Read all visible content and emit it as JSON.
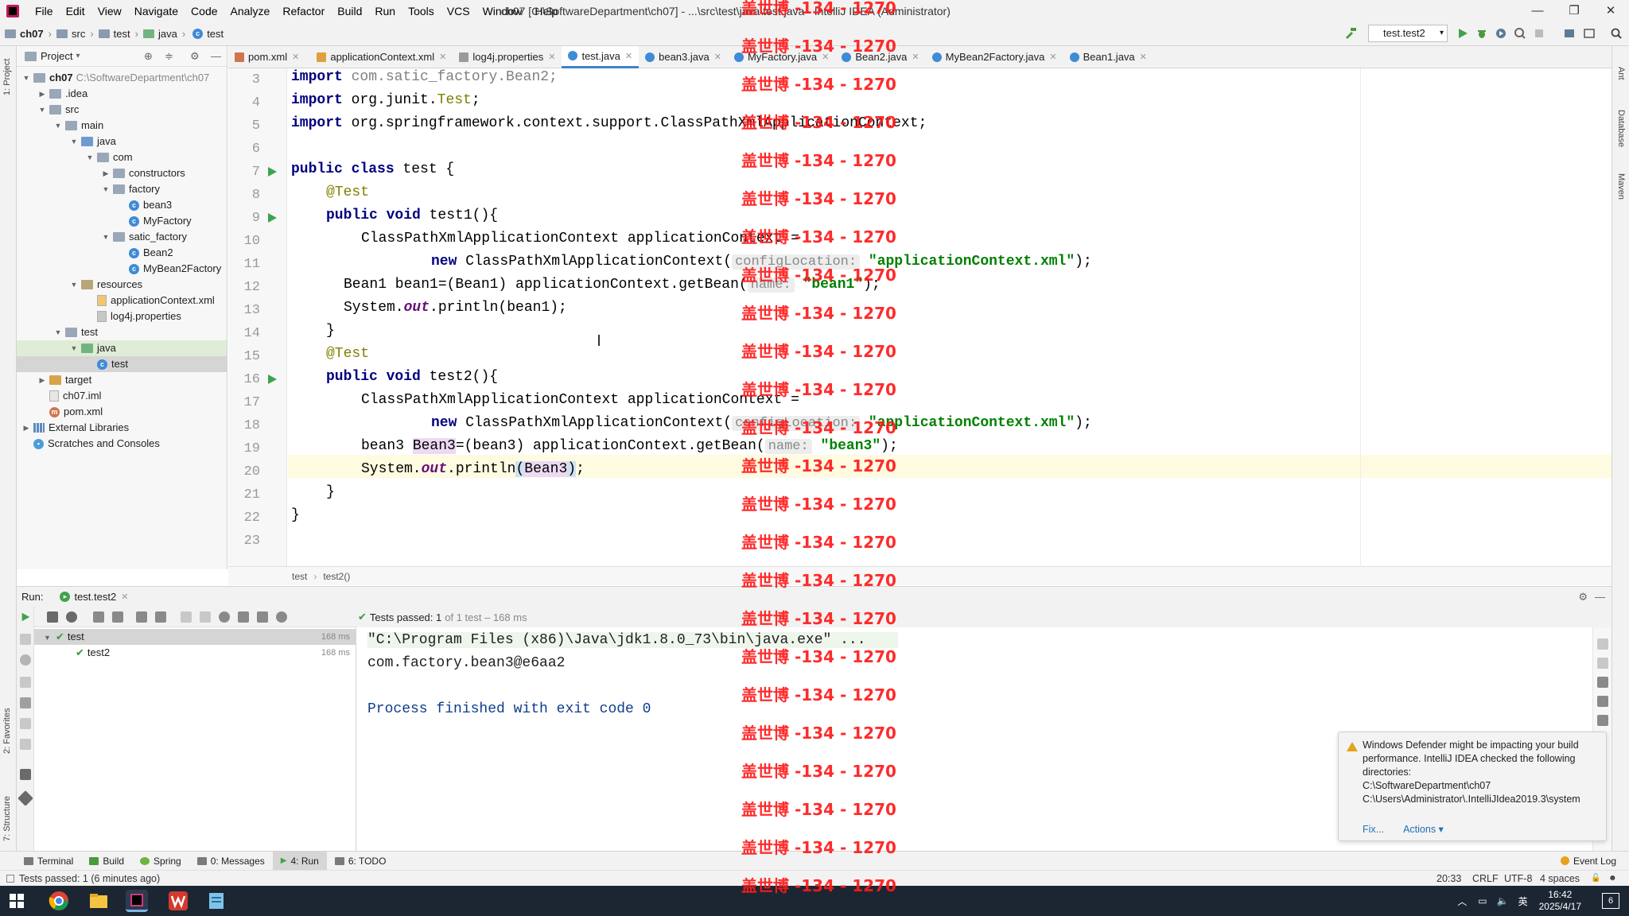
{
  "window": {
    "title": "ch07 [C:\\SoftwareDepartment\\ch07] - ...\\src\\test\\java\\test.java - IntelliJ IDEA (Administrator)",
    "menu": [
      "File",
      "Edit",
      "View",
      "Navigate",
      "Code",
      "Analyze",
      "Refactor",
      "Build",
      "Run",
      "Tools",
      "VCS",
      "Window",
      "Help"
    ],
    "controls": [
      "—",
      "❐",
      "✕"
    ]
  },
  "navbar": {
    "crumbs": [
      "ch07",
      "src",
      "test",
      "java",
      "test"
    ],
    "run_config": "test.test2"
  },
  "left_strip": {
    "project": "1: Project",
    "favorites": "2: Favorites",
    "structure": "7: Structure"
  },
  "right_strip": {
    "ant": "Ant",
    "database": "Database",
    "maven": "Maven"
  },
  "project_panel": {
    "title": "Project",
    "tree": [
      {
        "label": "ch07",
        "extra": "C:\\SoftwareDepartment\\ch07",
        "kind": "folder",
        "depth": 0,
        "expanded": true,
        "bold": true
      },
      {
        "label": ".idea",
        "kind": "folder",
        "depth": 1,
        "expanded": false
      },
      {
        "label": "src",
        "kind": "folder",
        "depth": 1,
        "expanded": true
      },
      {
        "label": "main",
        "kind": "folder",
        "depth": 2,
        "expanded": true
      },
      {
        "label": "java",
        "kind": "src",
        "depth": 3,
        "expanded": true
      },
      {
        "label": "com",
        "kind": "folder",
        "depth": 4,
        "expanded": true
      },
      {
        "label": "constructors",
        "kind": "folder",
        "depth": 5,
        "expanded": false
      },
      {
        "label": "factory",
        "kind": "folder",
        "depth": 5,
        "expanded": true
      },
      {
        "label": "bean3",
        "kind": "class",
        "depth": 6
      },
      {
        "label": "MyFactory",
        "kind": "class",
        "depth": 6
      },
      {
        "label": "satic_factory",
        "kind": "folder",
        "depth": 5,
        "expanded": true
      },
      {
        "label": "Bean2",
        "kind": "class",
        "depth": 6
      },
      {
        "label": "MyBean2Factory",
        "kind": "class",
        "depth": 6
      },
      {
        "label": "resources",
        "kind": "res",
        "depth": 3,
        "expanded": true
      },
      {
        "label": "applicationContext.xml",
        "kind": "xml",
        "depth": 4
      },
      {
        "label": "log4j.properties",
        "kind": "prop",
        "depth": 4
      },
      {
        "label": "test",
        "kind": "folder",
        "depth": 2,
        "expanded": true
      },
      {
        "label": "java",
        "kind": "tst",
        "depth": 3,
        "expanded": true,
        "highlight": true
      },
      {
        "label": "test",
        "kind": "class",
        "depth": 4,
        "selected": true
      },
      {
        "label": "target",
        "kind": "tgt",
        "depth": 1,
        "expanded": false
      },
      {
        "label": "ch07.iml",
        "kind": "file",
        "depth": 1
      },
      {
        "label": "pom.xml",
        "kind": "pom",
        "depth": 1
      },
      {
        "label": "External Libraries",
        "kind": "lib",
        "depth": 0,
        "expanded": false
      },
      {
        "label": "Scratches and Consoles",
        "kind": "scratch",
        "depth": 0
      }
    ]
  },
  "editor_tabs": [
    {
      "label": "pom.xml",
      "icon": "m"
    },
    {
      "label": "applicationContext.xml",
      "icon": "x"
    },
    {
      "label": "log4j.properties",
      "icon": "p"
    },
    {
      "label": "test.java",
      "icon": "c",
      "active": true
    },
    {
      "label": "bean3.java",
      "icon": "c"
    },
    {
      "label": "MyFactory.java",
      "icon": "c"
    },
    {
      "label": "Bean2.java",
      "icon": "c"
    },
    {
      "label": "MyBean2Factory.java",
      "icon": "c"
    },
    {
      "label": "Bean1.java",
      "icon": "c"
    }
  ],
  "editor": {
    "line_numbers": [
      "3",
      "4",
      "5",
      "6",
      "7",
      "8",
      "9",
      "10",
      "11",
      "12",
      "13",
      "14",
      "15",
      "16",
      "17",
      "18",
      "19",
      "20",
      "21",
      "22",
      "23"
    ],
    "code": {
      "l3_kw": "import",
      "l3_rest": " com.satic_factory.Bean2;",
      "l4_kw": "import",
      "l4_a": " org.junit.",
      "l4_b": "Test",
      "l4_c": ";",
      "l5_kw": "import",
      "l5_rest": " org.springframework.context.support.ClassPathXmlApplicationContext;",
      "l7_kw": "public class",
      "l7_rest": " test {",
      "l8_ann": "@Test",
      "l9_kw": "public void",
      "l9_rest": " test1(){",
      "l10": "ClassPathXmlApplicationContext applicationContext =",
      "l11_kw": "new",
      "l11_a": " ClassPathXmlApplicationContext(",
      "l11_hint": "configLocation:",
      "l11_str": "\"applicationContext.xml\"",
      "l11_b": ");",
      "l12_a": "Bean1 bean1=(Bean1) applicationContext.getBean(",
      "l12_hint": "name:",
      "l12_str": "\"bean1\"",
      "l12_b": ");",
      "l13_a": "System.",
      "l13_out": "out",
      "l13_b": ".println(bean1);",
      "l14": "}",
      "l15_ann": "@Test",
      "l16_kw": "public void",
      "l16_rest": " test2(){",
      "l17": "ClassPathXmlApplicationContext applicationContext =",
      "l18_kw": "new",
      "l18_a": " ClassPathXmlApplicationContext(",
      "l18_hint": "configLocation:",
      "l18_str": "\"applicationContext.xml\"",
      "l18_b": ");",
      "l19_a": "bean3 ",
      "l19_var": "Bean3",
      "l19_b": "=(bean3) applicationContext.getBean(",
      "l19_hint": "name:",
      "l19_str": "\"bean3\"",
      "l19_c": ");",
      "l20_a": "System.",
      "l20_out": "out",
      "l20_b": ".println",
      "l20_p1": "(",
      "l20_var": "Bean3",
      "l20_p2": ")",
      "l20_c": ";",
      "l21": "}",
      "l22": "}"
    },
    "breadcrumb": [
      "test",
      "test2()"
    ]
  },
  "run_panel": {
    "label": "Run:",
    "tab": "test.test2",
    "status": "Tests passed: 1",
    "status_detail": "of 1 test – 168 ms",
    "tree": [
      {
        "label": "test",
        "time": "168 ms"
      },
      {
        "label": "test2",
        "time": "168 ms"
      }
    ],
    "console": [
      "\"C:\\Program Files (x86)\\Java\\jdk1.8.0_73\\bin\\java.exe\" ...",
      "com.factory.bean3@e6aa2",
      "",
      "Process finished with exit code 0"
    ]
  },
  "notification": {
    "text": "Windows Defender might be impacting your build performance. IntelliJ IDEA checked the following directories:",
    "dir1": "C:\\SoftwareDepartment\\ch07",
    "dir2": "C:\\Users\\Administrator\\.IntelliJIdea2019.3\\system",
    "fix": "Fix...",
    "actions": "Actions ▾"
  },
  "tool_tabs": [
    "Terminal",
    "Build",
    "Spring",
    "0: Messages",
    "4: Run",
    "6: TODO"
  ],
  "event_log": "Event Log",
  "statusbar": {
    "message": "Tests passed: 1 (6 minutes ago)",
    "position": "20:33",
    "line_sep": "CRLF",
    "encoding": "UTF-8",
    "indent": "4 spaces"
  },
  "taskbar": {
    "time": "16:42",
    "date": "2025/4/17",
    "ime": "英",
    "notifications": "6"
  },
  "watermark": "盖世博 -134 - 1270",
  "colors": {
    "keyword": "#000080",
    "string": "#008000",
    "annotation": "#808000",
    "watermark": "#ff1a1a",
    "active_tab": "#4083c9"
  }
}
